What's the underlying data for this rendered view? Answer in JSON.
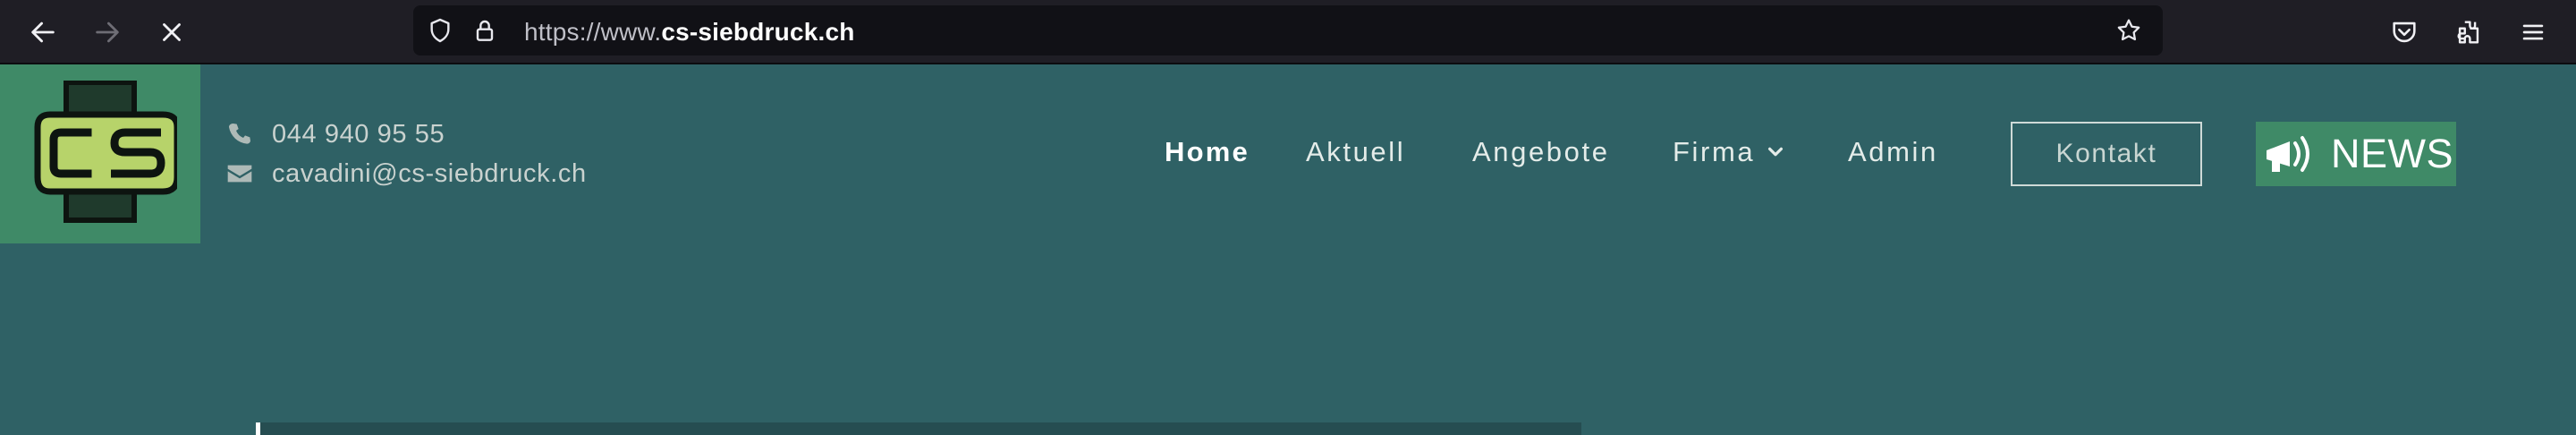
{
  "browser": {
    "url_prefix": "https://www.",
    "url_host": "cs-siebdruck.ch",
    "icons": [
      "back-arrow-icon",
      "forward-arrow-icon",
      "stop-icon",
      "shield-icon",
      "lock-icon",
      "bookmark-star-icon",
      "pocket-icon",
      "extensions-icon",
      "menu-icon"
    ]
  },
  "site": {
    "logo_text": "CS",
    "phone": "044 940 95 55",
    "email": "cavadini@cs-siebdruck.ch",
    "nav": {
      "home": "Home",
      "aktuell": "Aktuell",
      "angebote": "Angebote",
      "firma": "Firma",
      "admin": "Admin"
    },
    "kontakt_label": "Kontakt",
    "news_label": "NEWS",
    "colors": {
      "background": "#2f6165",
      "accent_green": "#3f8a67",
      "logo_lime": "#b7d36a"
    }
  }
}
